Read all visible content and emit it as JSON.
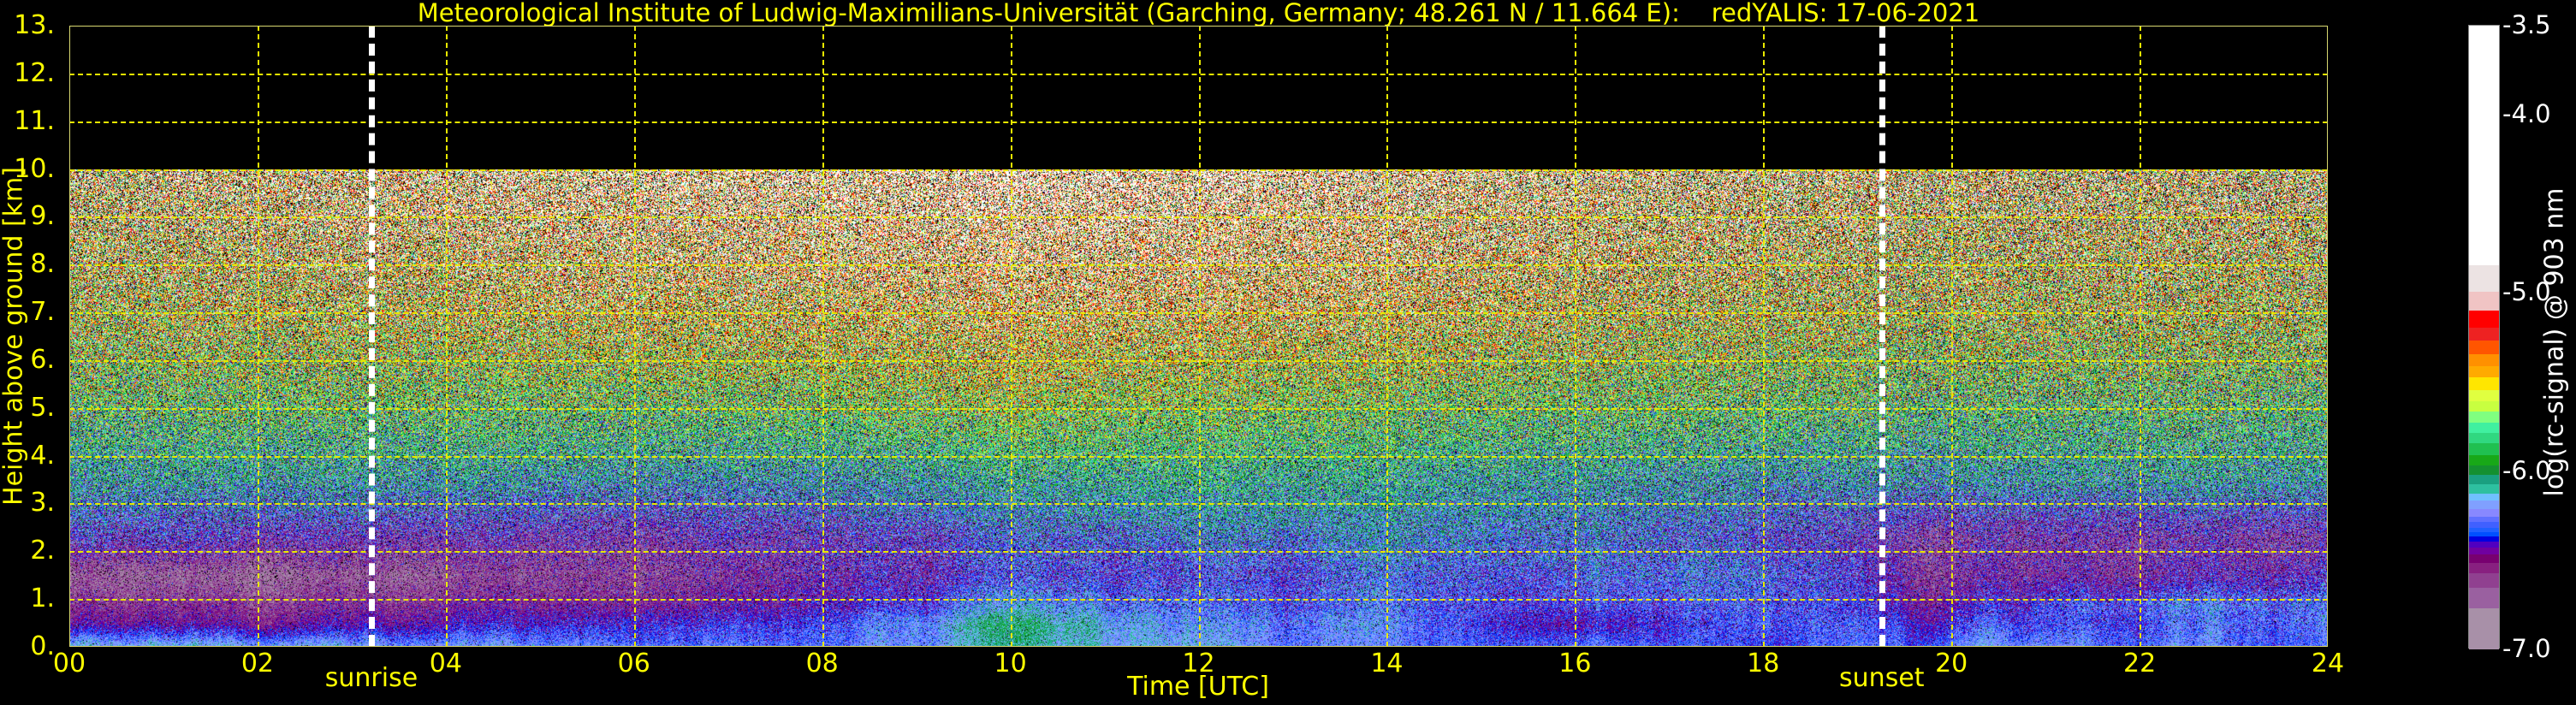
{
  "chart_data": {
    "type": "heatmap",
    "title": "Meteorological Institute of Ludwig-Maximilians-Universität (Garching, Germany; 48.261 N / 11.664 E):    redYALIS: 17-06-2021",
    "xlabel": "Time [UTC]",
    "ylabel": "Height above ground [km]",
    "xlim": [
      0,
      24
    ],
    "ylim": [
      0,
      13
    ],
    "data_top_km": 10,
    "grid": true,
    "xticks": [
      0,
      2,
      4,
      6,
      8,
      10,
      12,
      14,
      16,
      18,
      20,
      22,
      24
    ],
    "xtick_labels": [
      "00",
      "02",
      "04",
      "06",
      "08",
      "10",
      "12",
      "14",
      "16",
      "18",
      "20",
      "22",
      "24"
    ],
    "yticks": [
      0,
      1,
      2,
      3,
      4,
      5,
      6,
      7,
      8,
      9,
      10,
      11,
      12,
      13
    ],
    "ytick_labels": [
      "0.",
      "1.",
      "2.",
      "3.",
      "4.",
      "5.",
      "6.",
      "7.",
      "8.",
      "9.",
      "10.",
      "11.",
      "12.",
      "13."
    ],
    "annotations": [
      {
        "label": "sunrise",
        "time": 3.21
      },
      {
        "label": "sunset",
        "time": 19.26
      }
    ],
    "heatmap": {
      "times": [
        0,
        2,
        4,
        6,
        8,
        10,
        12,
        14,
        16,
        18,
        20,
        22,
        24
      ],
      "heights": [
        0.05,
        0.5,
        0.9,
        1.5,
        2.3,
        3.5,
        5,
        7,
        10
      ],
      "values": [
        [
          -6.2,
          -6.2,
          -6.25,
          -6.3,
          -6.3,
          -6.1,
          -6.15,
          -6.3,
          -6.3,
          -6.35,
          -6.25,
          -6.3,
          -6.3
        ],
        [
          -6.5,
          -6.5,
          -6.45,
          -6.4,
          -6.35,
          -6.05,
          -6.2,
          -6.25,
          -6.45,
          -6.3,
          -6.35,
          -6.35,
          -6.25
        ],
        [
          -6.6,
          -6.6,
          -6.55,
          -6.55,
          -6.45,
          -6.2,
          -6.25,
          -6.3,
          -6.35,
          -6.3,
          -6.45,
          -6.3,
          -6.25
        ],
        [
          -6.75,
          -6.75,
          -6.7,
          -6.65,
          -6.5,
          -6.35,
          -6.3,
          -6.3,
          -6.3,
          -6.25,
          -6.55,
          -6.55,
          -6.4
        ],
        [
          -6.4,
          -6.45,
          -6.5,
          -6.55,
          -6.45,
          -6.3,
          -6.2,
          -6.2,
          -6.25,
          -6.35,
          -6.55,
          -6.55,
          -6.55
        ],
        [
          -6.1,
          -6.1,
          -6.1,
          -6.15,
          -6.15,
          -6.05,
          -6.0,
          -6.05,
          -6.1,
          -6.15,
          -6.15,
          -6.1,
          -6.1
        ],
        [
          -5.9,
          -5.85,
          -5.85,
          -5.85,
          -5.8,
          -5.7,
          -5.75,
          -5.8,
          -5.85,
          -5.85,
          -5.9,
          -5.9,
          -5.9
        ],
        [
          -5.6,
          -5.55,
          -5.5,
          -5.45,
          -5.4,
          -5.3,
          -5.35,
          -5.4,
          -5.5,
          -5.55,
          -5.6,
          -5.6,
          -5.6
        ],
        [
          -5.3,
          -5.2,
          -5.1,
          -5.0,
          -4.95,
          -4.8,
          -4.85,
          -5.0,
          -5.15,
          -5.25,
          -5.3,
          -5.35,
          -5.35
        ]
      ]
    },
    "colorbar": {
      "label": "log(rc-signal) @ 903 nm",
      "range": [
        -7.0,
        -3.5
      ],
      "ticks": [
        -3.5,
        -4.0,
        -5.0,
        -6.0,
        -7.0
      ],
      "tick_labels": [
        "-3.5",
        "-4.0",
        "-5.0",
        "-6.0",
        "-7.0"
      ],
      "levels": [
        {
          "from": -4.844,
          "to": -3.5,
          "color": "#ffffff"
        },
        {
          "from": -4.993,
          "to": -4.844,
          "color": "#ece3e3"
        },
        {
          "from": -5.1,
          "to": -4.993,
          "color": "#f0c4c4"
        },
        {
          "from": -5.195,
          "to": -5.1,
          "color": "#ff0000"
        },
        {
          "from": -5.265,
          "to": -5.195,
          "color": "#ee2222"
        },
        {
          "from": -5.343,
          "to": -5.265,
          "color": "#ff5500"
        },
        {
          "from": -5.409,
          "to": -5.343,
          "color": "#ff9000"
        },
        {
          "from": -5.475,
          "to": -5.409,
          "color": "#ffaa00"
        },
        {
          "from": -5.543,
          "to": -5.475,
          "color": "#ffe600"
        },
        {
          "from": -5.606,
          "to": -5.543,
          "color": "#e0ff40"
        },
        {
          "from": -5.666,
          "to": -5.606,
          "color": "#c8ff40"
        },
        {
          "from": -5.727,
          "to": -5.666,
          "color": "#80ff80"
        },
        {
          "from": -5.787,
          "to": -5.727,
          "color": "#40f0a0"
        },
        {
          "from": -5.845,
          "to": -5.787,
          "color": "#30d880"
        },
        {
          "from": -5.908,
          "to": -5.845,
          "color": "#20c050"
        },
        {
          "from": -5.966,
          "to": -5.908,
          "color": "#18a818"
        },
        {
          "from": -6.019,
          "to": -5.966,
          "color": "#149030"
        },
        {
          "from": -6.075,
          "to": -6.019,
          "color": "#1aa080"
        },
        {
          "from": -6.125,
          "to": -6.075,
          "color": "#2ec0a0"
        },
        {
          "from": -6.166,
          "to": -6.125,
          "color": "#70c0ff"
        },
        {
          "from": -6.211,
          "to": -6.166,
          "color": "#80a0ff"
        },
        {
          "from": -6.254,
          "to": -6.211,
          "color": "#8888ff"
        },
        {
          "from": -6.287,
          "to": -6.254,
          "color": "#6070ff"
        },
        {
          "from": -6.317,
          "to": -6.287,
          "color": "#4060ff"
        },
        {
          "from": -6.342,
          "to": -6.317,
          "color": "#2060ff"
        },
        {
          "from": -6.367,
          "to": -6.342,
          "color": "#0050ff"
        },
        {
          "from": -6.393,
          "to": -6.367,
          "color": "#0000e0"
        },
        {
          "from": -6.428,
          "to": -6.393,
          "color": "#5000c0"
        },
        {
          "from": -6.468,
          "to": -6.428,
          "color": "#7000a0"
        },
        {
          "from": -6.514,
          "to": -6.468,
          "color": "#780070"
        },
        {
          "from": -6.572,
          "to": -6.514,
          "color": "#882080"
        },
        {
          "from": -6.652,
          "to": -6.572,
          "color": "#904090"
        },
        {
          "from": -6.771,
          "to": -6.652,
          "color": "#9a60a0"
        },
        {
          "from": -7.0,
          "to": -6.771,
          "color": "#a890a8"
        }
      ]
    },
    "colors": {
      "axis_text": "#ffff00",
      "grid": "#e8e800",
      "background": "#000000",
      "sun_lines": "#ffffff"
    }
  }
}
